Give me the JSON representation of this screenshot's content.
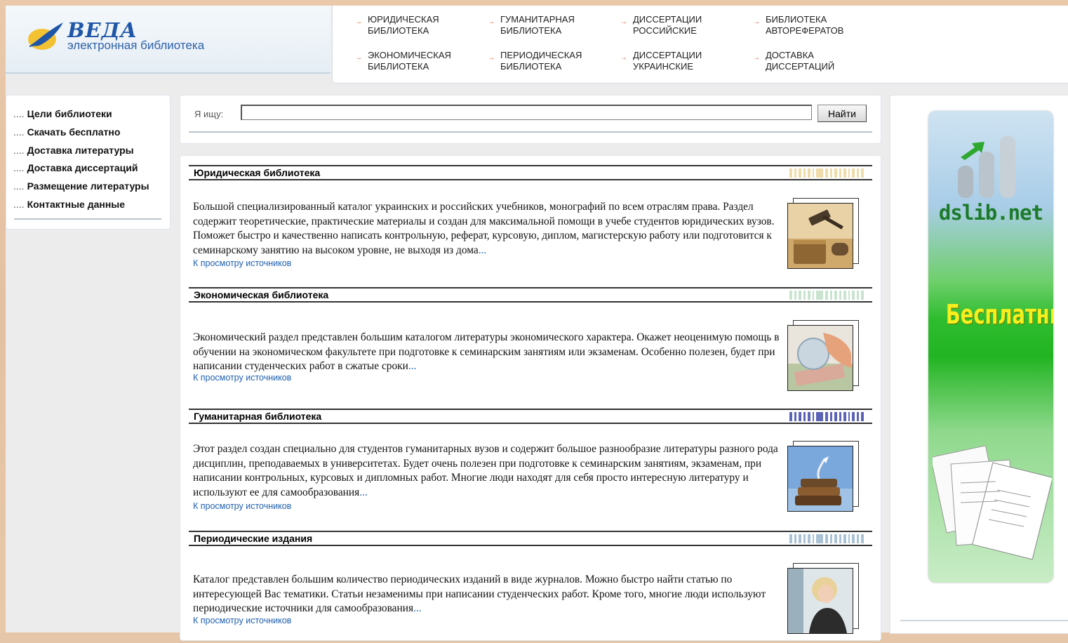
{
  "logo": {
    "title": "ВЕДА",
    "subtitle": "электронная библиотека"
  },
  "topnav": [
    {
      "line1": "ЮРИДИЧЕСКАЯ",
      "line2": "БИБЛИОТЕКА"
    },
    {
      "line1": "ГУМАНИТАРНАЯ",
      "line2": "БИБЛИОТЕКА"
    },
    {
      "line1": "ДИССЕРТАЦИИ",
      "line2": "РОССИЙСКИЕ"
    },
    {
      "line1": "БИБЛИОТЕКА",
      "line2": "АВТОРЕФЕРАТОВ"
    },
    {
      "line1": "ЭКОНОМИЧЕСКАЯ",
      "line2": "БИБЛИОТЕКА"
    },
    {
      "line1": "ПЕРИОДИЧЕСКАЯ",
      "line2": "БИБЛИОТЕКА"
    },
    {
      "line1": "ДИССЕРТАЦИИ",
      "line2": "УКРАИНСКИЕ"
    },
    {
      "line1": "ДОСТАВКА",
      "line2": "ДИССЕРТАЦИЙ"
    }
  ],
  "sidebar": {
    "dots": "....",
    "items": [
      "Цели библиотеки",
      "Скачать бесплатно",
      "Доставка литературы",
      "Доставка диссертаций",
      "Размещение литературы",
      "Контактные данные"
    ]
  },
  "search": {
    "label": "Я ищу:",
    "value": "",
    "button": "Найти"
  },
  "sections": [
    {
      "title": "Юридическая библиотека",
      "text": "Большой специализированный каталог украинских и российских учебников, монографий по всем отраслям права. Раздел содержит теоретические, практические материалы и создан для максимальной помощи в учебе студентов юридических вузов. Поможет быстро и качественно написать контрольную, реферат, курсовую, диплом, магистерскую работу или подготовится к семинарскому занятию на высоком уровне, не выходя из дома",
      "ellipsis": "...",
      "link": "К просмотру источников",
      "stripe_color": "#f0dca8"
    },
    {
      "title": "Экономическая библиотека",
      "text": "Экономический раздел представлен большим каталогом литературы экономического характера. Окажет неоценимую помощь в обучении на экономическом факультете при подготовке к семинарским занятиям или экзаменам. Особенно полезен, будет при написании студенческих работ в сжатые сроки",
      "ellipsis": "...",
      "link": "К просмотру источников",
      "stripe_color": "#c9e3cf"
    },
    {
      "title": "Гуманитарная библиотека",
      "text": "Этот раздел создан специально для студентов гуманитарных вузов и содержит большое разнообразие литературы разного рода дисциплин, преподаваемых в университетах. Будет очень полезен при подготовке к семинарским занятиям, экзаменам, при написании контрольных, курсовых и дипломных работ. Многие люди находят для себя просто интересную литературу и используют ее для самообразования",
      "ellipsis": "...",
      "link": "К просмотру источников",
      "stripe_color": "#5b63b8"
    },
    {
      "title": "Периодические издания",
      "text": "Каталог представлен большим количество периодических изданий в виде журналов. Можно быстро найти статью по интересующей Вас тематики. Статьи незаменимы при написании студенческих работ. Кроме того, многие люди используют периодические источники для самообразования",
      "ellipsis": "...",
      "link": "К просмотру источников",
      "stripe_color": "#a9c2d6"
    }
  ],
  "banner": {
    "site": "dslib.net",
    "free": "Бесплатные"
  }
}
